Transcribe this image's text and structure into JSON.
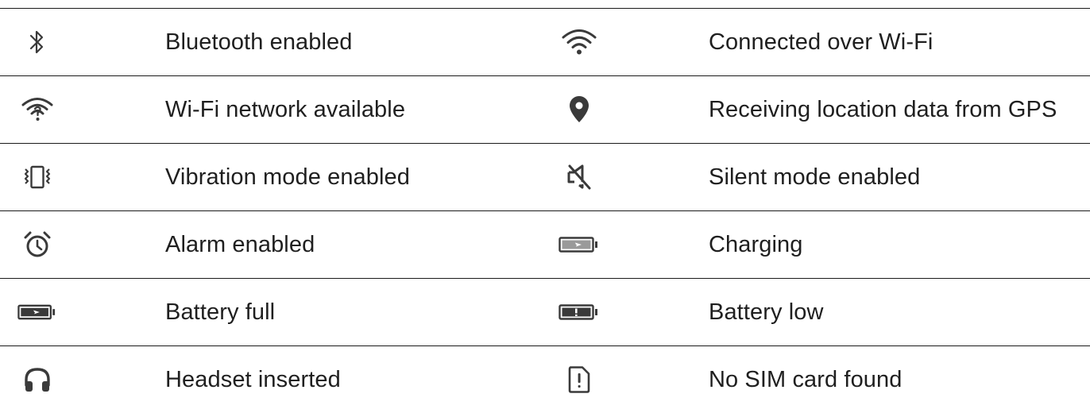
{
  "icon_color": "#3a3a3a",
  "rows": [
    {
      "left": {
        "icon": "bluetooth-icon",
        "label": "Bluetooth enabled"
      },
      "right": {
        "icon": "wifi-connected-icon",
        "label": "Connected over Wi-Fi"
      }
    },
    {
      "left": {
        "icon": "wifi-available-icon",
        "label": "Wi-Fi network available"
      },
      "right": {
        "icon": "location-pin-icon",
        "label": "Receiving location data from GPS"
      }
    },
    {
      "left": {
        "icon": "vibration-icon",
        "label": "Vibration mode enabled"
      },
      "right": {
        "icon": "silent-mode-icon",
        "label": "Silent mode enabled"
      }
    },
    {
      "left": {
        "icon": "alarm-clock-icon",
        "label": "Alarm enabled"
      },
      "right": {
        "icon": "battery-charging-icon",
        "label": "Charging"
      }
    },
    {
      "left": {
        "icon": "battery-full-icon",
        "label": "Battery full"
      },
      "right": {
        "icon": "battery-low-icon",
        "label": "Battery low"
      }
    },
    {
      "left": {
        "icon": "headset-icon",
        "label": "Headset inserted"
      },
      "right": {
        "icon": "no-sim-icon",
        "label": "No SIM card found"
      }
    }
  ]
}
